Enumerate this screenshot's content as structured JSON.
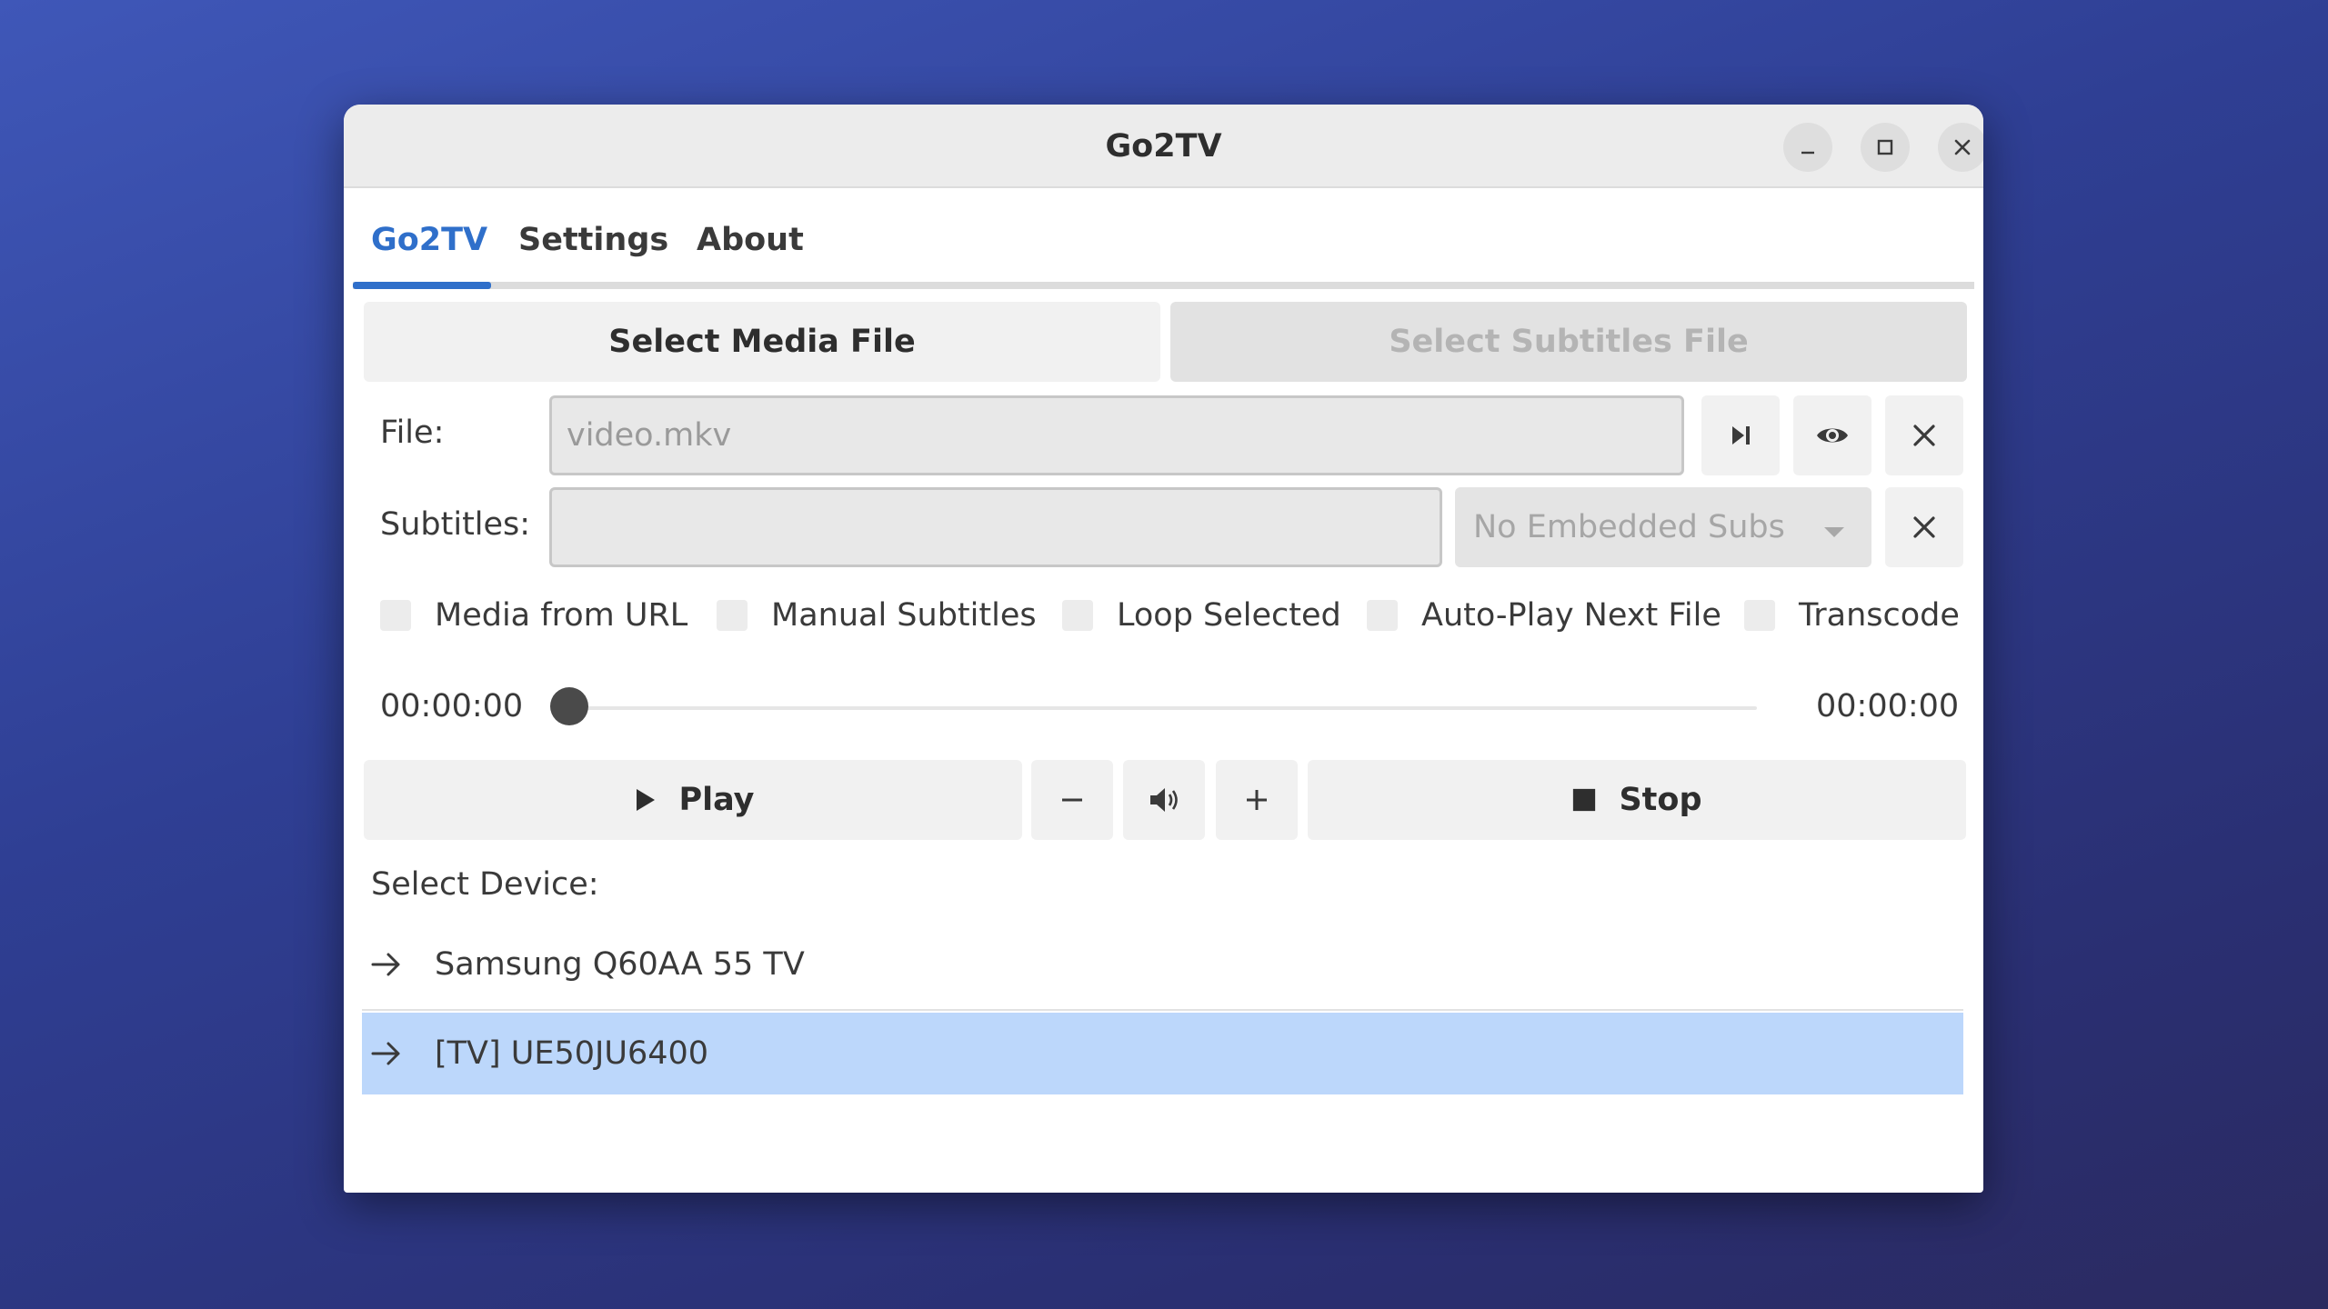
{
  "window": {
    "title": "Go2TV"
  },
  "tabs": [
    {
      "label": "Go2TV",
      "active": true
    },
    {
      "label": "Settings",
      "active": false
    },
    {
      "label": "About",
      "active": false
    }
  ],
  "buttons": {
    "select_media": "Select Media File",
    "select_subtitles": "Select Subtitles File",
    "play": "Play",
    "stop": "Stop"
  },
  "file": {
    "label": "File:",
    "placeholder": "video.mkv",
    "value": ""
  },
  "subtitles": {
    "label": "Subtitles:",
    "value": "",
    "embedded_select": "No Embedded Subs"
  },
  "options": [
    {
      "label": "Media from URL",
      "checked": false
    },
    {
      "label": "Manual Subtitles",
      "checked": false
    },
    {
      "label": "Loop Selected",
      "checked": false
    },
    {
      "label": "Auto-Play Next File",
      "checked": false
    },
    {
      "label": "Transcode",
      "checked": false
    }
  ],
  "playback": {
    "elapsed": "00:00:00",
    "total": "00:00:00",
    "position": 0
  },
  "devices": {
    "label": "Select Device:",
    "items": [
      {
        "name": "Samsung Q60AA 55 TV",
        "selected": false
      },
      {
        "name": "[TV] UE50JU6400",
        "selected": true
      }
    ]
  },
  "colors": {
    "accent": "#2f6fca",
    "selection": "#bcd7fb",
    "background": "#3a4aa8"
  }
}
